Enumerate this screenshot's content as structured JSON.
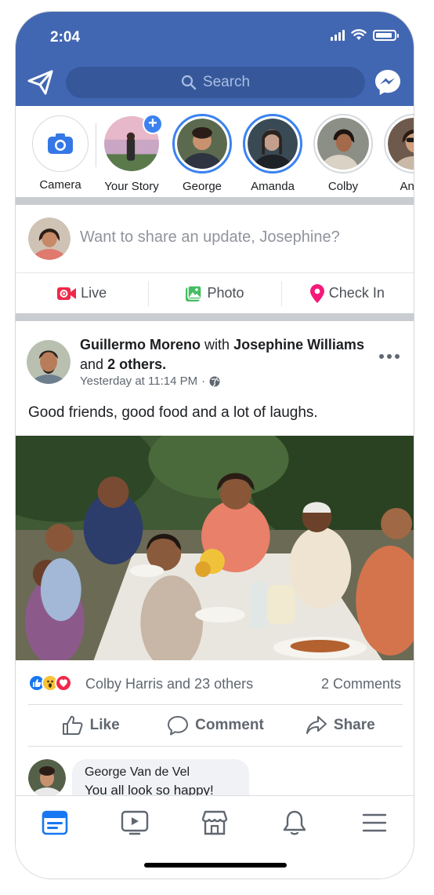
{
  "status_bar": {
    "time": "2:04"
  },
  "header": {
    "search_placeholder": "Search"
  },
  "stories": [
    {
      "label": "Camera",
      "type": "camera"
    },
    {
      "label": "Your Story",
      "type": "own"
    },
    {
      "label": "George",
      "type": "active"
    },
    {
      "label": "Amanda",
      "type": "active"
    },
    {
      "label": "Colby",
      "type": "seen"
    },
    {
      "label": "Anna",
      "type": "seen"
    }
  ],
  "composer": {
    "placeholder": "Want to share an update, Josephine?"
  },
  "composer_actions": {
    "live": "Live",
    "photo": "Photo",
    "checkin": "Check In"
  },
  "post": {
    "author": "Guillermo Moreno",
    "with_word": "with",
    "tagged": "Josephine Williams",
    "and_word": "and",
    "others": "2 others.",
    "time": "Yesterday at 11:14 PM",
    "separator": "·",
    "text": "Good friends, good food and a lot of laughs.",
    "reactions_text": "Colby Harris and 23 others",
    "comments_count": "2 Comments",
    "actions": {
      "like": "Like",
      "comment": "Comment",
      "share": "Share"
    }
  },
  "comment": {
    "author": "George Van de Vel",
    "text": "You all look so happy!"
  },
  "colors": {
    "brand": "#4267b2",
    "story_ring": "#3b82f0",
    "live_red": "#f02849",
    "photo_green": "#45bd62",
    "checkin_pink": "#f5197a"
  }
}
